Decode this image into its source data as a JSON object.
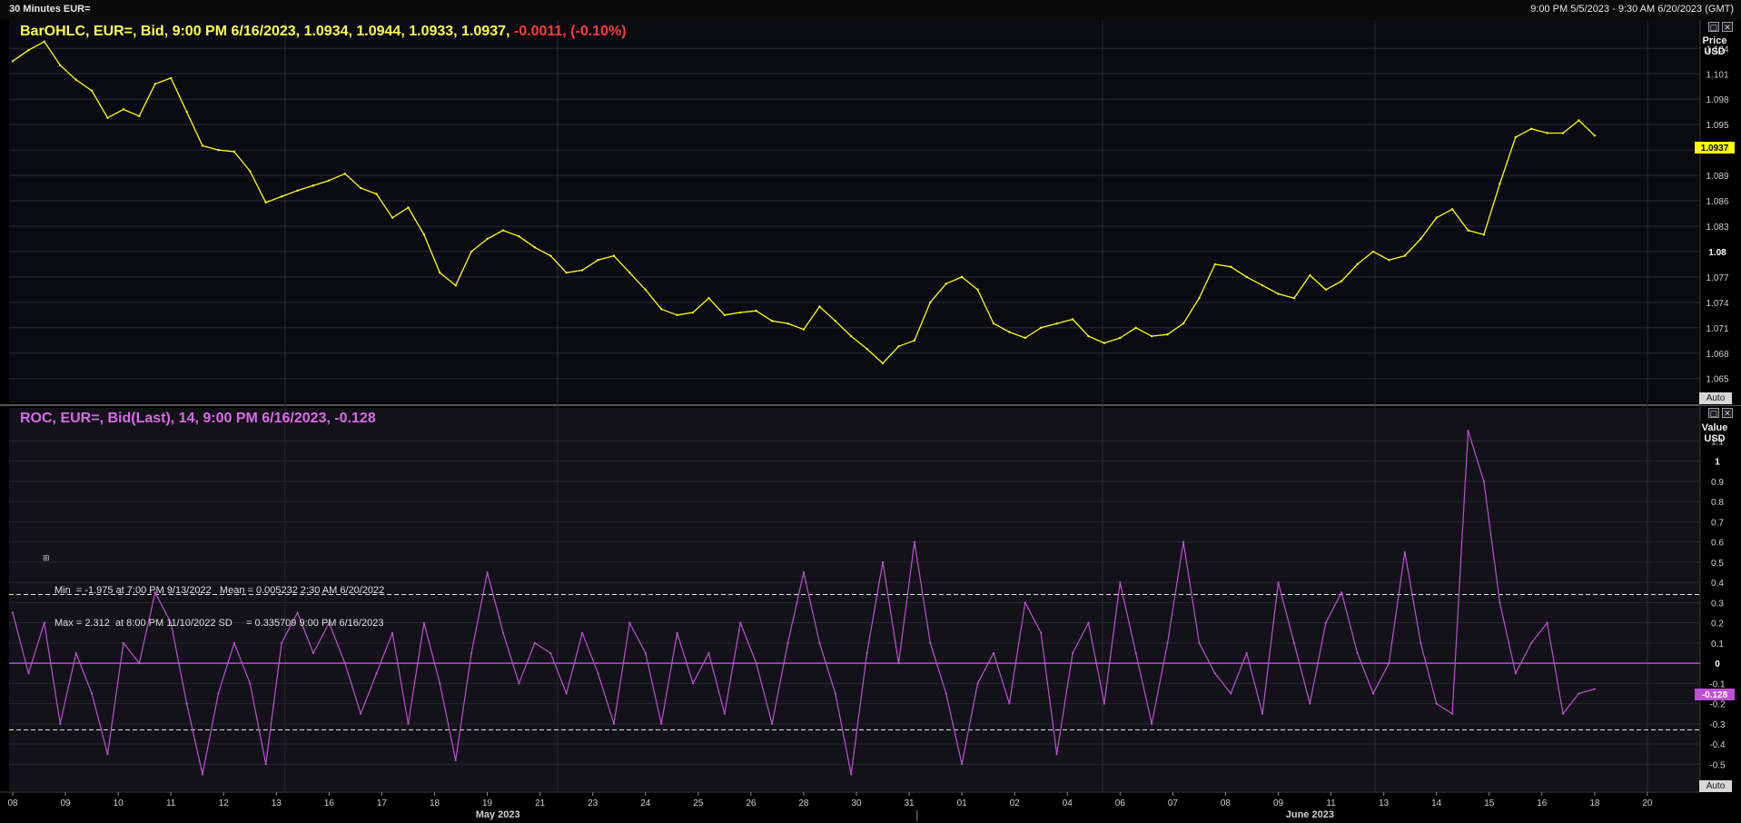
{
  "window": {
    "title": "30 Minutes EUR=",
    "range": "9:00 PM 5/5/2023 - 9:30 AM 6/20/2023 (GMT)"
  },
  "price_panel": {
    "legend": "BarOHLC, EUR=, Bid, 9:00 PM 6/16/2023, 1.0934, 1.0944, 1.0933, 1.0937,",
    "change": "-0.0011, (-0.10%)",
    "unit_line1": "Price",
    "unit_line2": "USD",
    "last_price_tag": "1.0937",
    "auto_label": "Auto"
  },
  "roc_panel": {
    "legend": "ROC, EUR=, Bid(Last),  14, 9:00 PM 6/16/2023, -0.128",
    "unit_line1": "Value",
    "unit_line2": "USD",
    "last_value_tag": "-0.128",
    "auto_label": "Auto",
    "stats_line1": "Min  = -1.975 at 7:00 PM 9/13/2022   Mean = 0.005232 2:30 AM 6/20/2022",
    "stats_line2": "Max = 2.312  at 8:00 PM 11/10/2022 SD     = 0.335709 9:00 PM 6/16/2023"
  },
  "colors": {
    "price_line": "#ffff00",
    "roc_line": "#c04fd6",
    "change_negative": "#ff3b3b",
    "background": "#0a0a12",
    "grid": "#2c2c34"
  },
  "chart_data": [
    {
      "type": "line",
      "title": "BarOHLC, EUR=, Bid",
      "ylabel": "Price USD",
      "ylim": [
        1.0625,
        1.1065
      ],
      "yticks": [
        "1.104",
        "1.101",
        "1.098",
        "1.095",
        "1.092",
        "1.089",
        "1.086",
        "1.083",
        "1.08",
        "1.077",
        "1.074",
        "1.071",
        "1.068",
        "1.065"
      ],
      "x_tick_labels": [
        "08",
        "09",
        "10",
        "11",
        "12",
        "13",
        "16",
        "17",
        "18",
        "19",
        "21",
        "23",
        "24",
        "25",
        "26",
        "28",
        "30",
        "31",
        "01",
        "02",
        "04",
        "06",
        "07",
        "08",
        "09",
        "11",
        "13",
        "14",
        "15",
        "16",
        "18",
        "20"
      ],
      "month_labels": [
        "May 2023",
        "June 2023"
      ],
      "x_index_range": [
        0,
        32
      ],
      "series": [
        {
          "name": "EUR= Bid",
          "x": [
            0,
            0.3,
            0.6,
            0.9,
            1.2,
            1.5,
            1.8,
            2.1,
            2.4,
            2.7,
            3.0,
            3.3,
            3.6,
            3.9,
            4.2,
            4.5,
            4.8,
            5.1,
            5.4,
            5.7,
            6.0,
            6.3,
            6.6,
            6.9,
            7.2,
            7.5,
            7.8,
            8.1,
            8.4,
            8.7,
            9.0,
            9.3,
            9.6,
            9.9,
            10.2,
            10.5,
            10.8,
            11.1,
            11.4,
            11.7,
            12.0,
            12.3,
            12.6,
            12.9,
            13.2,
            13.5,
            13.8,
            14.1,
            14.4,
            14.7,
            15.0,
            15.3,
            15.6,
            15.9,
            16.2,
            16.5,
            16.8,
            17.1,
            17.4,
            17.7,
            18.0,
            18.3,
            18.6,
            18.9,
            19.2,
            19.5,
            19.8,
            20.1,
            20.4,
            20.7,
            21.0,
            21.3,
            21.6,
            21.9,
            22.2,
            22.5,
            22.8,
            23.1,
            23.4,
            23.7,
            24.0,
            24.3,
            24.6,
            24.9,
            25.2,
            25.5,
            25.8,
            26.1,
            26.4,
            26.7,
            27.0,
            27.3,
            27.6,
            27.9,
            28.2,
            28.5,
            28.8,
            29.1,
            29.4,
            29.7,
            30.0
          ],
          "y": [
            1.1025,
            1.1038,
            1.1048,
            1.102,
            1.1003,
            1.099,
            1.0958,
            1.0968,
            1.096,
            1.0998,
            1.1005,
            1.0965,
            1.0925,
            1.092,
            1.0918,
            1.0895,
            1.0858,
            1.0865,
            1.0872,
            1.0878,
            1.0884,
            1.0892,
            1.0875,
            1.0868,
            1.084,
            1.0852,
            1.082,
            1.0775,
            1.076,
            1.08,
            1.0815,
            1.0825,
            1.0818,
            1.0805,
            1.0795,
            1.0775,
            1.0778,
            1.079,
            1.0795,
            1.0775,
            1.0755,
            1.0732,
            1.0725,
            1.0728,
            1.0745,
            1.0725,
            1.0728,
            1.073,
            1.0718,
            1.0715,
            1.0708,
            1.0735,
            1.0718,
            1.07,
            1.0685,
            1.0668,
            1.0688,
            1.0695,
            1.074,
            1.0762,
            1.077,
            1.0755,
            1.0715,
            1.0705,
            1.0698,
            1.071,
            1.0715,
            1.072,
            1.07,
            1.0692,
            1.0698,
            1.071,
            1.07,
            1.0702,
            1.0715,
            1.0745,
            1.0785,
            1.0782,
            1.077,
            1.076,
            1.075,
            1.0745,
            1.0772,
            1.0755,
            1.0765,
            1.0785,
            1.08,
            1.079,
            1.0795,
            1.0815,
            1.084,
            1.085,
            1.0825,
            1.082,
            1.088,
            1.0935,
            1.0945,
            1.094,
            1.094,
            1.0955,
            1.0937
          ]
        }
      ]
    },
    {
      "type": "line",
      "title": "ROC, EUR=, Bid(Last), 14",
      "ylabel": "Value USD",
      "ylim": [
        -0.62,
        1.25
      ],
      "yticks": [
        "1.1",
        "1",
        "0.9",
        "0.8",
        "0.7",
        "0.6",
        "0.5",
        "0.4",
        "0.3",
        "0.2",
        "0.1",
        "0",
        "-0.1",
        "-0.2",
        "-0.3",
        "-0.4",
        "-0.5"
      ],
      "reference_lines": [
        0.34,
        0,
        -0.33
      ],
      "series": [
        {
          "name": "ROC 14",
          "x": [
            0,
            0.3,
            0.6,
            0.9,
            1.2,
            1.5,
            1.8,
            2.1,
            2.4,
            2.7,
            3.0,
            3.3,
            3.6,
            3.9,
            4.2,
            4.5,
            4.8,
            5.1,
            5.4,
            5.7,
            6.0,
            6.3,
            6.6,
            6.9,
            7.2,
            7.5,
            7.8,
            8.1,
            8.4,
            8.7,
            9.0,
            9.3,
            9.6,
            9.9,
            10.2,
            10.5,
            10.8,
            11.1,
            11.4,
            11.7,
            12.0,
            12.3,
            12.6,
            12.9,
            13.2,
            13.5,
            13.8,
            14.1,
            14.4,
            14.7,
            15.0,
            15.3,
            15.6,
            15.9,
            16.2,
            16.5,
            16.8,
            17.1,
            17.4,
            17.7,
            18.0,
            18.3,
            18.6,
            18.9,
            19.2,
            19.5,
            19.8,
            20.1,
            20.4,
            20.7,
            21.0,
            21.3,
            21.6,
            21.9,
            22.2,
            22.5,
            22.8,
            23.1,
            23.4,
            23.7,
            24.0,
            24.3,
            24.6,
            24.9,
            25.2,
            25.5,
            25.8,
            26.1,
            26.4,
            26.7,
            27.0,
            27.3,
            27.6,
            27.9,
            28.2,
            28.5,
            28.8,
            29.1,
            29.4,
            29.7,
            30.0
          ],
          "y": [
            0.25,
            -0.05,
            0.2,
            -0.3,
            0.05,
            -0.15,
            -0.45,
            0.1,
            0.0,
            0.35,
            0.2,
            -0.2,
            -0.55,
            -0.15,
            0.1,
            -0.1,
            -0.5,
            0.1,
            0.25,
            0.05,
            0.2,
            0.0,
            -0.25,
            -0.05,
            0.15,
            -0.3,
            0.2,
            -0.1,
            -0.48,
            0.05,
            0.45,
            0.15,
            -0.1,
            0.1,
            0.05,
            -0.15,
            0.15,
            -0.05,
            -0.3,
            0.2,
            0.05,
            -0.3,
            0.15,
            -0.1,
            0.05,
            -0.25,
            0.2,
            0.0,
            -0.3,
            0.1,
            0.45,
            0.1,
            -0.15,
            -0.55,
            0.05,
            0.5,
            0.0,
            0.6,
            0.1,
            -0.15,
            -0.5,
            -0.1,
            0.05,
            -0.2,
            0.3,
            0.15,
            -0.45,
            0.05,
            0.2,
            -0.2,
            0.4,
            0.05,
            -0.3,
            0.1,
            0.6,
            0.1,
            -0.05,
            -0.15,
            0.05,
            -0.25,
            0.4,
            0.1,
            -0.2,
            0.2,
            0.35,
            0.05,
            -0.15,
            0.0,
            0.55,
            0.1,
            -0.2,
            -0.25,
            1.15,
            0.9,
            0.3,
            -0.05,
            0.1,
            0.2,
            -0.25,
            -0.15,
            -0.128
          ]
        }
      ]
    }
  ]
}
